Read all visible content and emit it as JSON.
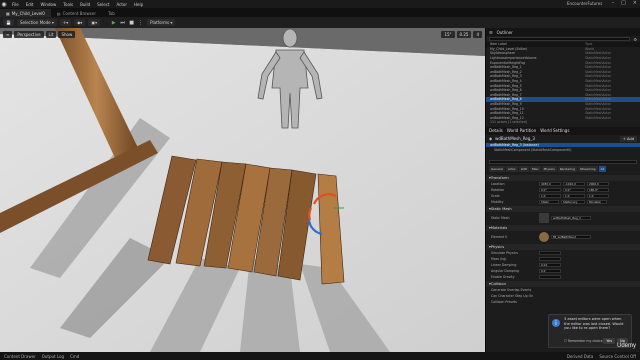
{
  "titlebar": {
    "menu": [
      "File",
      "Edit",
      "Window",
      "Tools",
      "Build",
      "Select",
      "Actor",
      "Help"
    ],
    "project": "EncounterFutures"
  },
  "tabs": [
    {
      "label": "My_Child_Level0",
      "active": true
    },
    {
      "label": "Content Browser",
      "active": false
    },
    {
      "label": "Tab",
      "active": false
    }
  ],
  "toolbar": {
    "save": "",
    "mode": "Selection Mode",
    "platforms": "Platforms"
  },
  "viewport": {
    "tools": [
      "Perspective",
      "Lit",
      "Show"
    ],
    "right_tools": [
      "15°",
      "0.25",
      "4"
    ]
  },
  "outliner": {
    "title": "Outliner",
    "columns": [
      "Item Label",
      "Type"
    ],
    "items": [
      {
        "name": "My_Child_Level (Editor)",
        "type": "World"
      },
      {
        "name": "SkyAtmosphere",
        "type": "StaticMeshActor"
      },
      {
        "name": "LightmassImportanceVolume",
        "type": "StaticMeshActor"
      },
      {
        "name": "ExponentialHeightFog",
        "type": "StaticMeshActor"
      },
      {
        "name": "wdBathMesh_Reg_1",
        "type": "StaticMeshActor"
      },
      {
        "name": "wdBathMesh_Reg_2",
        "type": "StaticMeshActor"
      },
      {
        "name": "wdBathMesh_Reg_3",
        "type": "StaticMeshActor"
      },
      {
        "name": "wdBathMesh_Reg_4",
        "type": "StaticMeshActor"
      },
      {
        "name": "wdBathMesh_Reg_5",
        "type": "StaticMeshActor"
      },
      {
        "name": "wdBathMesh_Reg_6",
        "type": "StaticMeshActor"
      },
      {
        "name": "wdBathMesh_Reg_7",
        "type": "StaticMeshActor"
      },
      {
        "name": "wdBathMesh_Reg_8",
        "type": "StaticMeshActor"
      },
      {
        "name": "wdBathMesh_Reg_9",
        "type": "StaticMeshActor"
      },
      {
        "name": "wdBathMesh_Reg_10",
        "type": "StaticMeshActor"
      },
      {
        "name": "wdBathMesh_Reg_11",
        "type": "StaticMeshActor"
      },
      {
        "name": "wdBathMesh_Reg_12",
        "type": "StaticMeshActor"
      }
    ],
    "selected_index": 11,
    "footer": "111 actors (1 selected)"
  },
  "details": {
    "tabs": [
      "Details",
      "World Partition",
      "World Settings"
    ],
    "actor_name": "wdBathMesh_Reg_3",
    "add_label": "+ Add",
    "component": "wdBathMesh_Reg_3 (Instance)",
    "subcomponent": "StaticMeshComponent (StaticMeshComponent0)",
    "filters": [
      "General",
      "Actor",
      "LOD",
      "Misc",
      "Physics",
      "Rendering",
      "Streaming",
      "All"
    ],
    "sections": {
      "transform": "Transform",
      "static_mesh": "Static Mesh",
      "materials": "Materials",
      "physics": "Physics",
      "collision": "Collision"
    },
    "transform": [
      {
        "label": "Location",
        "values": [
          "4030.0",
          "-1010.0",
          "2000.0"
        ]
      },
      {
        "label": "Rotation",
        "values": [
          "0.0°",
          "0.0°",
          "180.0°"
        ]
      },
      {
        "label": "Scale",
        "values": [
          "1.0",
          "1.0",
          "1.0"
        ]
      }
    ],
    "mobility": [
      "Static",
      "Stationary",
      "Movable"
    ],
    "static_mesh_label": "Static Mesh",
    "static_mesh_value": "wdBathMesh_Reg_3",
    "element_label": "Element 0",
    "element_value": "MI_wdBathWood",
    "physics_props": [
      "Simulate Physics",
      "Mass (kg)",
      "Linear Damping",
      "Angular Damping",
      "Enable Gravity"
    ],
    "physics_values": [
      "",
      "",
      "0.01",
      "0.0",
      ""
    ],
    "collision_props": [
      "Generate Overlap Events",
      "Can Character Step Up On",
      "Collision Presets"
    ]
  },
  "toast": {
    "message": "3 asset editors were open when the editor was last closed. Would you like to re-open them?",
    "checkbox": "Remember my choice",
    "yes": "Yes",
    "no": "No"
  },
  "bottom": {
    "left": [
      "Content Drawer",
      "Output Log",
      "Cmd"
    ],
    "right": [
      "Derived Data",
      "Source Control Off"
    ]
  },
  "watermark": "Udemy",
  "colors": {
    "accent": "#1d4f8a",
    "floor": "#efefef",
    "wood": "#9a6a3c"
  }
}
